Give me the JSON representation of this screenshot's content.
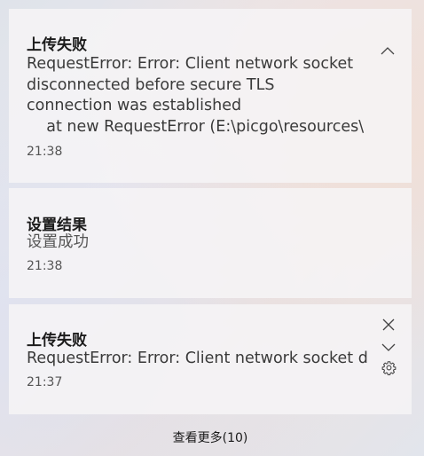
{
  "notifications": [
    {
      "title": "上传失败",
      "body": "RequestError: Error: Client network socket\ndisconnected before secure TLS\nconnection was established\n    at new RequestError (E:\\picgo\\resources\\",
      "time": "21:38",
      "expanded": true,
      "icons": [
        "chevron-up-icon"
      ]
    },
    {
      "title": "设置结果",
      "body": "设置成功",
      "time": "21:38",
      "icons": []
    },
    {
      "title": "上传失败",
      "body": "RequestError: Error: Client network socket d",
      "time": "21:37",
      "icons": [
        "close-icon",
        "chevron-down-icon",
        "gear-icon"
      ]
    }
  ],
  "footer": {
    "more_label": "查看更多(10)"
  },
  "colors": {
    "card_bg": "#f6f4f6",
    "title_text": "#1b1b1b",
    "body_text": "#3a3a3a",
    "time_text": "#555555"
  }
}
